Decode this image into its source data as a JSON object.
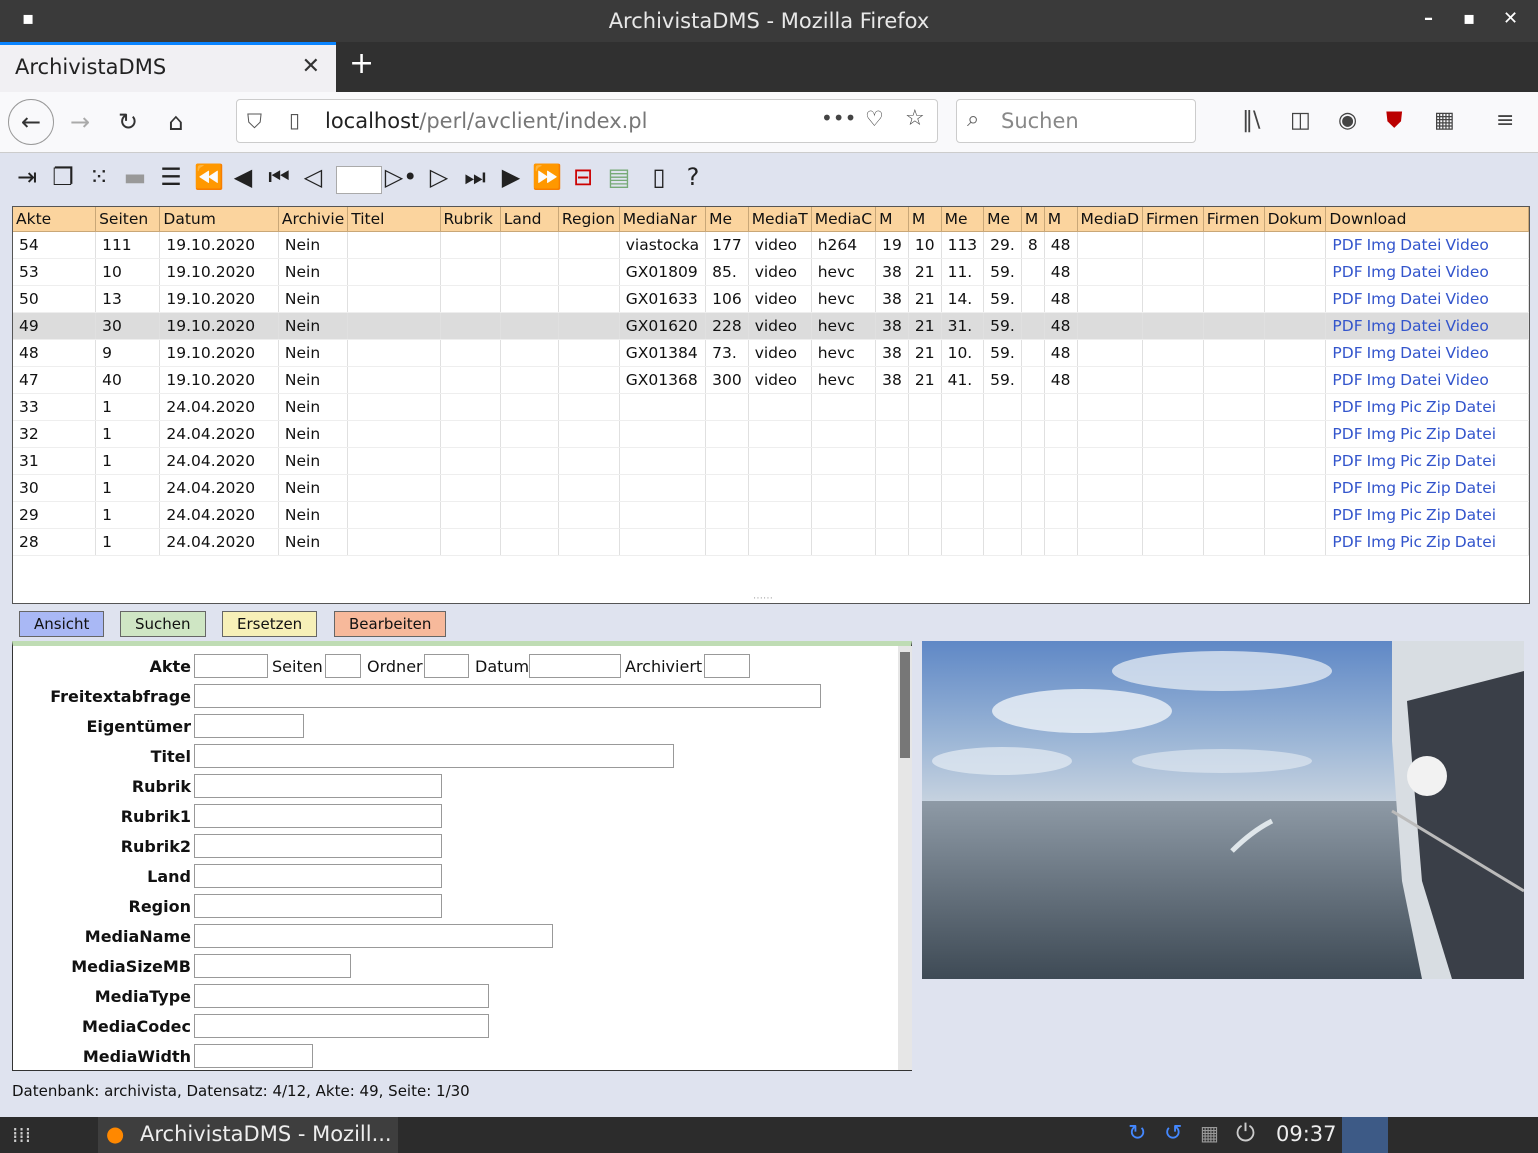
{
  "window": {
    "title": "ArchivistaDMS - Mozilla Firefox"
  },
  "browser": {
    "tab_label": "ArchivistaDMS",
    "url_host": "localhost",
    "url_path": "/perl/avclient/index.pl",
    "search_placeholder": "Suchen"
  },
  "toolbar": {
    "help": "?"
  },
  "grid": {
    "columns": [
      "Akte",
      "Seiten",
      "Datum",
      "Archivie",
      "Titel",
      "Rubrik",
      "Land",
      "Region",
      "MediaNar",
      "Me",
      "MediaT",
      "MediaC",
      "M",
      "M",
      "Me",
      "Me",
      "M",
      "M",
      "MediaD",
      "Firmen",
      "Firmen",
      "Dokum",
      "Download"
    ],
    "rows": [
      {
        "cells": [
          "54",
          "111",
          "19.10.2020",
          "Nein",
          "",
          "",
          "",
          "",
          "viastocka",
          "177",
          "video",
          "h264",
          "19",
          "10",
          "113",
          "29.",
          "8",
          "48",
          "",
          "",
          "",
          ""
        ],
        "links": [
          "PDF",
          "Img",
          "Datei",
          "Video"
        ]
      },
      {
        "cells": [
          "53",
          "10",
          "19.10.2020",
          "Nein",
          "",
          "",
          "",
          "",
          "GX01809",
          "85.",
          "video",
          "hevc",
          "38",
          "21",
          "11.",
          "59.",
          "",
          "48",
          "",
          "",
          "",
          ""
        ],
        "links": [
          "PDF",
          "Img",
          "Datei",
          "Video"
        ]
      },
      {
        "cells": [
          "50",
          "13",
          "19.10.2020",
          "Nein",
          "",
          "",
          "",
          "",
          "GX01633",
          "106",
          "video",
          "hevc",
          "38",
          "21",
          "14.",
          "59.",
          "",
          "48",
          "",
          "",
          "",
          ""
        ],
        "links": [
          "PDF",
          "Img",
          "Datei",
          "Video"
        ]
      },
      {
        "cells": [
          "49",
          "30",
          "19.10.2020",
          "Nein",
          "",
          "",
          "",
          "",
          "GX01620",
          "228",
          "video",
          "hevc",
          "38",
          "21",
          "31.",
          "59.",
          "",
          "48",
          "",
          "",
          "",
          ""
        ],
        "links": [
          "PDF",
          "Img",
          "Datei",
          "Video"
        ]
      },
      {
        "cells": [
          "48",
          "9",
          "19.10.2020",
          "Nein",
          "",
          "",
          "",
          "",
          "GX01384",
          "73.",
          "video",
          "hevc",
          "38",
          "21",
          "10.",
          "59.",
          "",
          "48",
          "",
          "",
          "",
          ""
        ],
        "links": [
          "PDF",
          "Img",
          "Datei",
          "Video"
        ]
      },
      {
        "cells": [
          "47",
          "40",
          "19.10.2020",
          "Nein",
          "",
          "",
          "",
          "",
          "GX01368",
          "300",
          "video",
          "hevc",
          "38",
          "21",
          "41.",
          "59.",
          "",
          "48",
          "",
          "",
          "",
          ""
        ],
        "links": [
          "PDF",
          "Img",
          "Datei",
          "Video"
        ]
      },
      {
        "cells": [
          "33",
          "1",
          "24.04.2020",
          "Nein",
          "",
          "",
          "",
          "",
          "",
          "",
          "",
          "",
          "",
          "",
          "",
          "",
          "",
          "",
          "",
          "",
          "",
          ""
        ],
        "links": [
          "PDF",
          "Img",
          "Pic",
          "Zip",
          "Datei"
        ]
      },
      {
        "cells": [
          "32",
          "1",
          "24.04.2020",
          "Nein",
          "",
          "",
          "",
          "",
          "",
          "",
          "",
          "",
          "",
          "",
          "",
          "",
          "",
          "",
          "",
          "",
          "",
          ""
        ],
        "links": [
          "PDF",
          "Img",
          "Pic",
          "Zip",
          "Datei"
        ]
      },
      {
        "cells": [
          "31",
          "1",
          "24.04.2020",
          "Nein",
          "",
          "",
          "",
          "",
          "",
          "",
          "",
          "",
          "",
          "",
          "",
          "",
          "",
          "",
          "",
          "",
          "",
          ""
        ],
        "links": [
          "PDF",
          "Img",
          "Pic",
          "Zip",
          "Datei"
        ]
      },
      {
        "cells": [
          "30",
          "1",
          "24.04.2020",
          "Nein",
          "",
          "",
          "",
          "",
          "",
          "",
          "",
          "",
          "",
          "",
          "",
          "",
          "",
          "",
          "",
          "",
          "",
          ""
        ],
        "links": [
          "PDF",
          "Img",
          "Pic",
          "Zip",
          "Datei"
        ]
      },
      {
        "cells": [
          "29",
          "1",
          "24.04.2020",
          "Nein",
          "",
          "",
          "",
          "",
          "",
          "",
          "",
          "",
          "",
          "",
          "",
          "",
          "",
          "",
          "",
          "",
          "",
          ""
        ],
        "links": [
          "PDF",
          "Img",
          "Pic",
          "Zip",
          "Datei"
        ]
      },
      {
        "cells": [
          "28",
          "1",
          "24.04.2020",
          "Nein",
          "",
          "",
          "",
          "",
          "",
          "",
          "",
          "",
          "",
          "",
          "",
          "",
          "",
          "",
          "",
          "",
          "",
          ""
        ],
        "links": [
          "PDF",
          "Img",
          "Pic",
          "Zip",
          "Datei"
        ]
      }
    ],
    "selected_row_index": 3
  },
  "tabs": {
    "ansicht": "Ansicht",
    "suchen": "Suchen",
    "ersetzen": "Ersetzen",
    "bearbeiten": "Bearbeiten",
    "colors": {
      "ansicht": "#a9b8f5",
      "suchen": "#cfe6c4",
      "ersetzen": "#f7f0b8",
      "bearbeiten": "#f7b99b"
    }
  },
  "form": {
    "akte": "Akte",
    "seiten": "Seiten",
    "ordner": "Ordner",
    "datum": "Datum",
    "archiviert": "Archiviert",
    "freitext": "Freitextabfrage",
    "eigentuemer": "Eigentümer",
    "titel": "Titel",
    "rubrik": "Rubrik",
    "rubrik1": "Rubrik1",
    "rubrik2": "Rubrik2",
    "land": "Land",
    "region": "Region",
    "medianame": "MediaName",
    "mediasize": "MediaSizeMB",
    "mediatype": "MediaType",
    "mediacodec": "MediaCodec",
    "mediawidth": "MediaWidth"
  },
  "status": "Datenbank: archivista, Datensatz: 4/12, Akte: 49, Seite: 1/30",
  "taskbar": {
    "task_label": "ArchivistaDMS - Mozill...",
    "clock": "09:37"
  }
}
